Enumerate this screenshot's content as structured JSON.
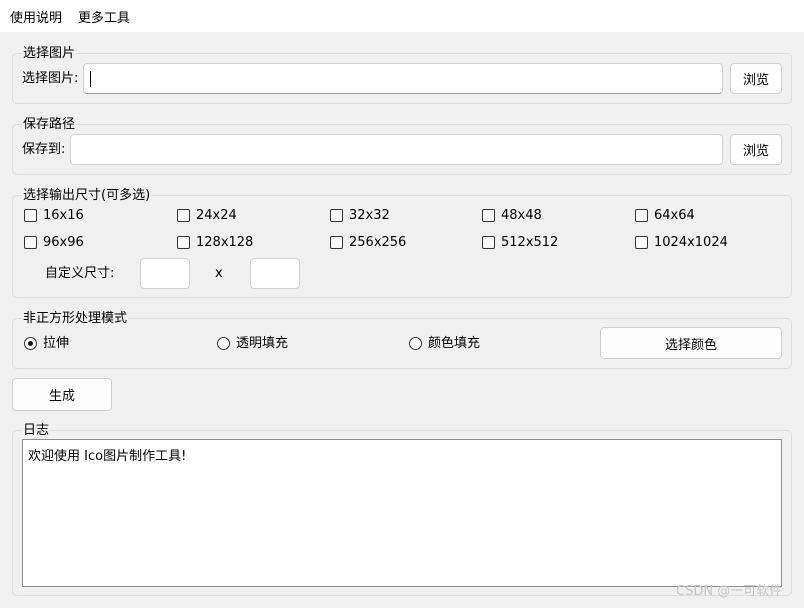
{
  "menu": {
    "usage": "使用说明",
    "more_tools": "更多工具"
  },
  "select_image": {
    "group_title": "选择图片",
    "label": "选择图片:",
    "value": "",
    "browse_label": "浏览"
  },
  "save_path": {
    "group_title": "保存路径",
    "label": "保存到:",
    "value": "",
    "browse_label": "浏览"
  },
  "output_sizes": {
    "group_title": "选择输出尺寸(可多选)",
    "options": [
      {
        "label": "16x16",
        "checked": false
      },
      {
        "label": "24x24",
        "checked": false
      },
      {
        "label": "32x32",
        "checked": false
      },
      {
        "label": "48x48",
        "checked": false
      },
      {
        "label": "64x64",
        "checked": false
      },
      {
        "label": "96x96",
        "checked": false
      },
      {
        "label": "128x128",
        "checked": false
      },
      {
        "label": "256x256",
        "checked": false
      },
      {
        "label": "512x512",
        "checked": false
      },
      {
        "label": "1024x1024",
        "checked": false
      }
    ],
    "custom_label": "自定义尺寸:",
    "custom_width": "",
    "custom_height": "",
    "times": "x"
  },
  "mode": {
    "group_title": "非正方形处理模式",
    "stretch": "拉伸",
    "transparent_fill": "透明填充",
    "color_fill": "颜色填充",
    "selected": "stretch",
    "choose_color_label": "选择颜色"
  },
  "generate_label": "生成",
  "log": {
    "group_title": "日志",
    "content": "欢迎使用 Ico图片制作工具!"
  },
  "watermark": "CSDN @一可软件"
}
